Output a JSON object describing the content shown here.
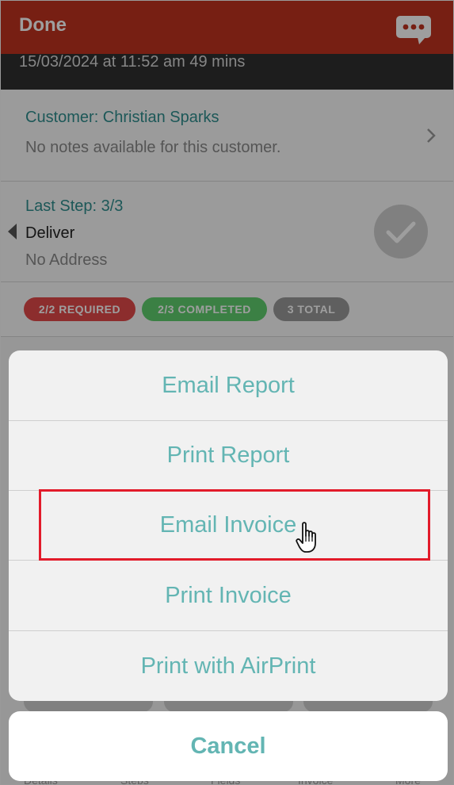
{
  "header": {
    "done_label": "Done",
    "chat_icon": "chat-bubble-icon",
    "datetime": "15/03/2024 at 11:52 am   49 mins"
  },
  "customer": {
    "label": "Customer: Christian Sparks",
    "notes": "No notes available for this customer."
  },
  "step": {
    "label": "Last Step: 3/3",
    "action": "Deliver",
    "address": "No Address"
  },
  "badges": {
    "required": "2/2 REQUIRED",
    "completed": "2/3 COMPLETED",
    "total": "3 TOTAL"
  },
  "action_sheet": {
    "items": [
      {
        "label": "Email Report"
      },
      {
        "label": "Print Report"
      },
      {
        "label": "Email Invoice"
      },
      {
        "label": "Print Invoice"
      },
      {
        "label": "Print with AirPrint"
      }
    ],
    "cancel_label": "Cancel"
  },
  "tabs": [
    "Details",
    "Steps",
    "Fields",
    "Invoice",
    "More"
  ],
  "colors": {
    "header": "#c0321f",
    "accent": "#63b5b3",
    "highlight": "#e21b2a"
  }
}
